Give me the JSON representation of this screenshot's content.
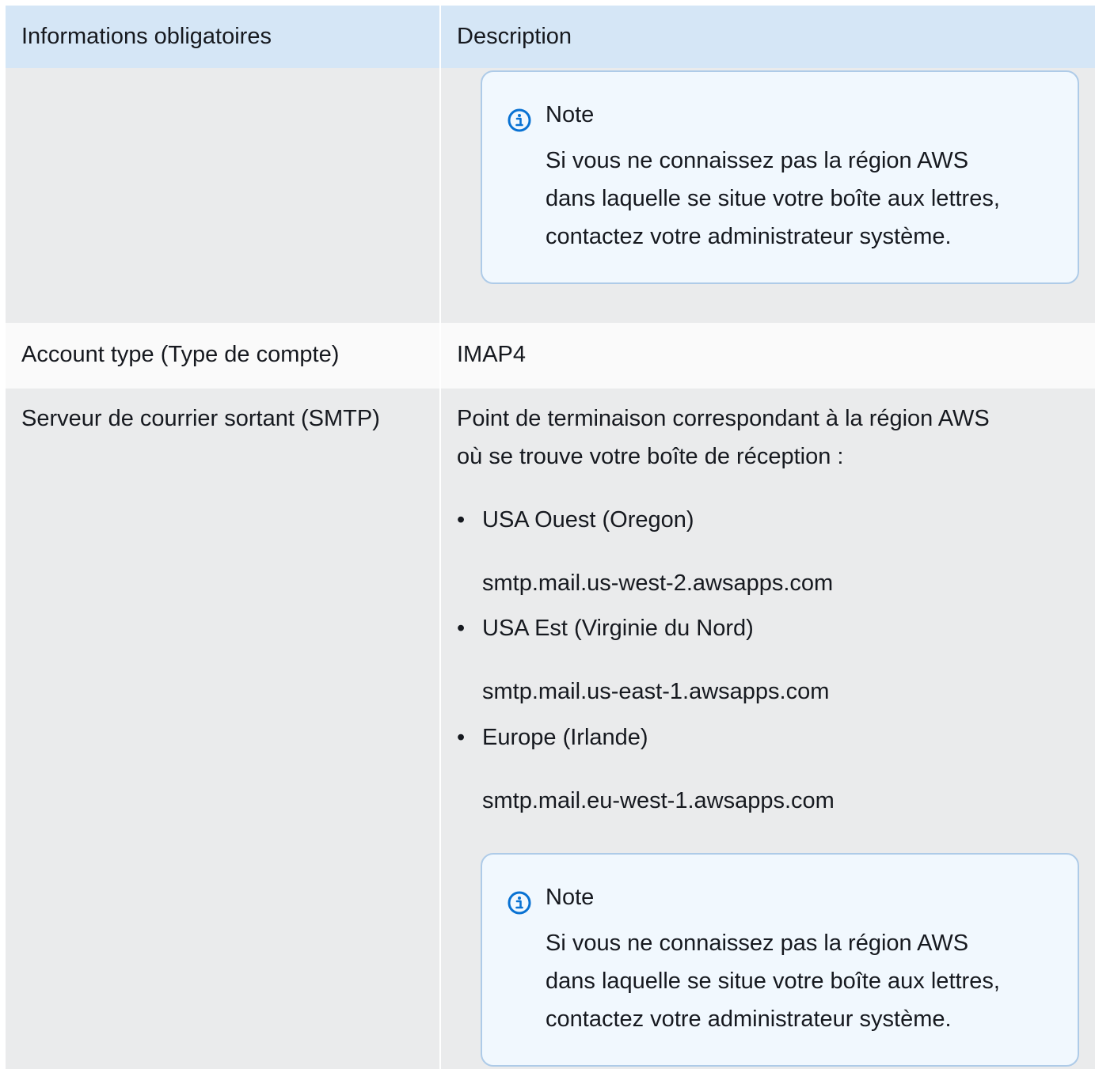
{
  "table": {
    "headers": [
      "Informations obligatoires",
      "Description"
    ]
  },
  "rows": [
    {
      "label": "",
      "note": {
        "title": "Note",
        "lines": [
          "Si vous ne connaissez pas la région AWS",
          "dans laquelle se situe votre boîte aux lettres,",
          "contactez votre administrateur système."
        ]
      }
    },
    {
      "label": "Account type (Type de compte)",
      "value": "IMAP4"
    },
    {
      "label": "Serveur de courrier sortant (SMTP)",
      "intro": [
        "Point de terminaison correspondant à la région AWS",
        "où se trouve votre boîte de réception :"
      ],
      "regions": [
        {
          "name": "USA Ouest (Oregon)",
          "endpoint": "smtp.mail.us-west-2.awsapps.com"
        },
        {
          "name": "USA Est (Virginie du Nord)",
          "endpoint": "smtp.mail.us-east-1.awsapps.com"
        },
        {
          "name": "Europe (Irlande)",
          "endpoint": "smtp.mail.eu-west-1.awsapps.com"
        }
      ],
      "bullet": "•",
      "note": {
        "title": "Note",
        "lines": [
          "Si vous ne connaissez pas la région AWS",
          "dans laquelle se situe votre boîte aux lettres,",
          "contactez votre administrateur système."
        ]
      }
    }
  ],
  "colors": {
    "header_bg": "#d5e6f6",
    "row_gray": "#eaebec",
    "row_white": "#fafafa",
    "note_bg": "#f1f8fe",
    "note_border": "#aecbe8",
    "info_icon": "#0972d3"
  },
  "icons": {
    "note": "info-circle-icon"
  }
}
